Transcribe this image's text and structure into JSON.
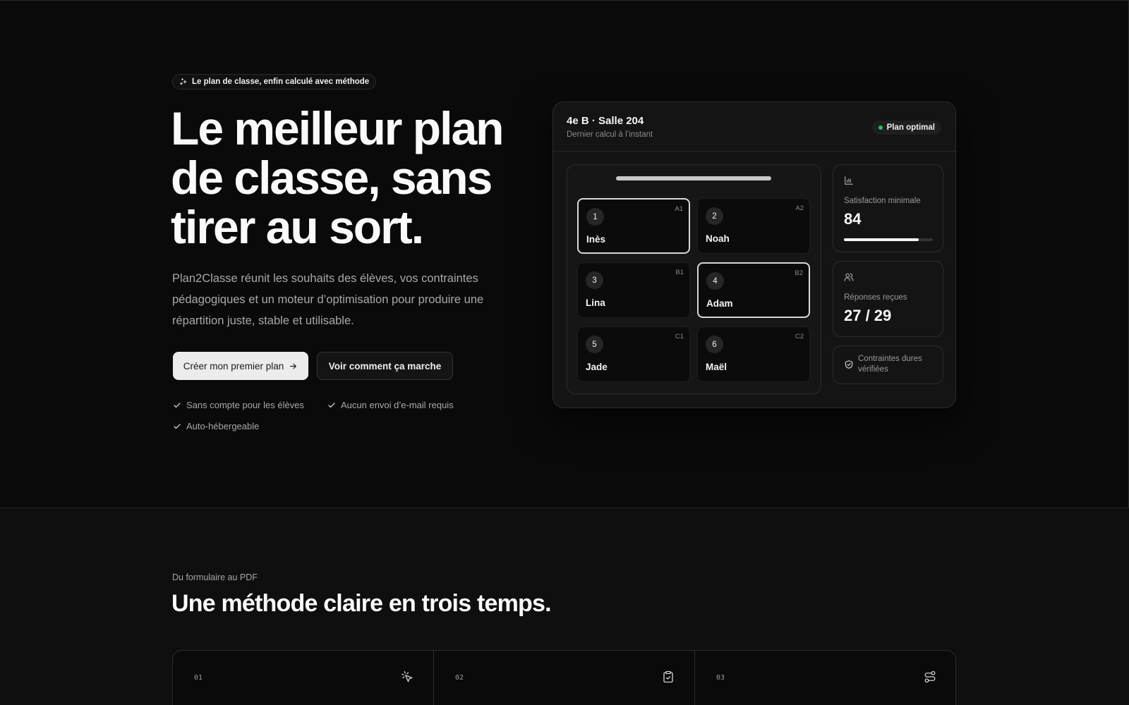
{
  "hero": {
    "badge": "Le plan de classe, enfin calculé avec méthode",
    "title": "Le meilleur plan de classe, sans tirer au sort.",
    "description": "Plan2Classe réunit les souhaits des élèves, vos contraintes pédagogiques et un moteur d’optimisation pour produire une répartition juste, stable et utilisable.",
    "primary_cta": "Créer mon premier plan",
    "secondary_cta": "Voir comment ça marche",
    "checks": [
      "Sans compte pour les élèves",
      "Aucun envoi d’e-mail requis",
      "Auto-hébergeable"
    ]
  },
  "panel": {
    "title": "4e B · Salle 204",
    "subtitle": "Dernier calcul à l’instant",
    "status": "Plan optimal",
    "status_color": "#22c55e",
    "seats": [
      {
        "num": "1",
        "code": "A1",
        "name": "Inès",
        "selected": true
      },
      {
        "num": "2",
        "code": "A2",
        "name": "Noah",
        "selected": false
      },
      {
        "num": "3",
        "code": "B1",
        "name": "Lina",
        "selected": false
      },
      {
        "num": "4",
        "code": "B2",
        "name": "Adam",
        "selected": true
      },
      {
        "num": "5",
        "code": "C1",
        "name": "Jade",
        "selected": false
      },
      {
        "num": "6",
        "code": "C2",
        "name": "Maël",
        "selected": false
      }
    ],
    "stats": {
      "satisfaction_label": "Satisfaction minimale",
      "satisfaction_value": "84",
      "satisfaction_progress": 0.84,
      "responses_label": "Réponses reçues",
      "responses_value": "27 / 29",
      "constraints_label": "Contraintes dures vérifiées"
    }
  },
  "method": {
    "eyebrow": "Du formulaire au PDF",
    "title": "Une méthode claire en trois temps.",
    "steps": [
      {
        "num": "01",
        "icon": "pointer-click-icon"
      },
      {
        "num": "02",
        "icon": "clipboard-check-icon"
      },
      {
        "num": "03",
        "icon": "route-icon"
      }
    ]
  }
}
